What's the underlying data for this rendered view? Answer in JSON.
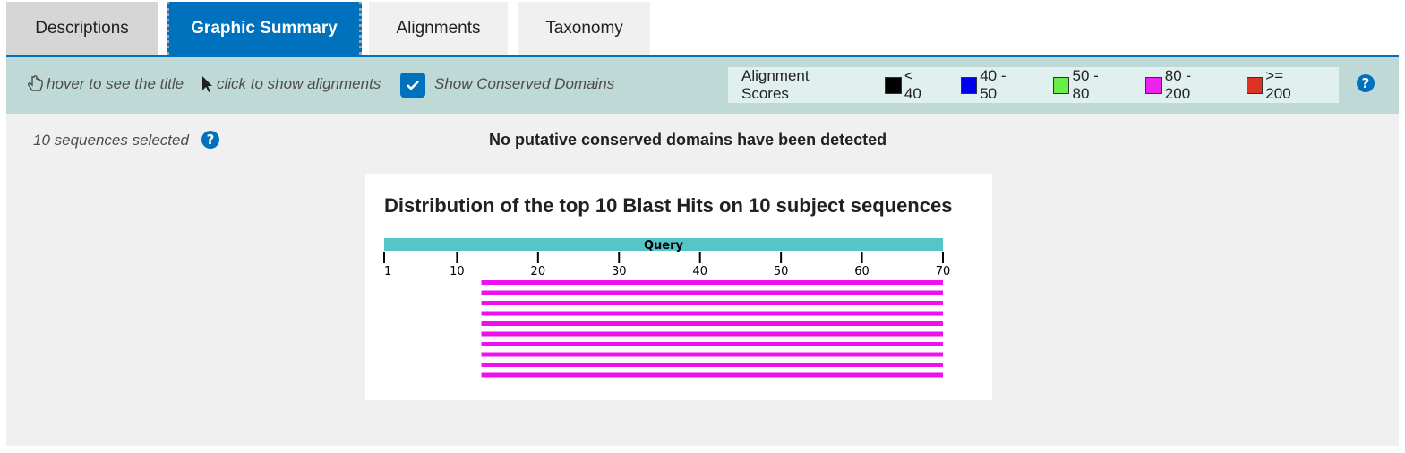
{
  "tabs": [
    {
      "label": "Descriptions",
      "active": false
    },
    {
      "label": "Graphic Summary",
      "active": true
    },
    {
      "label": "Alignments",
      "active": false
    },
    {
      "label": "Taxonomy",
      "active": false
    }
  ],
  "toolbar": {
    "hover_hint": "hover to see the title",
    "click_hint": "click to show alignments",
    "show_cd_label": "Show Conserved Domains",
    "show_cd_checked": true,
    "legend_title": "Alignment Scores",
    "legend": [
      {
        "label": "< 40",
        "color": "#000000"
      },
      {
        "label": "40 - 50",
        "color": "#0000ee"
      },
      {
        "label": "50 - 80",
        "color": "#66ee44"
      },
      {
        "label": "80 - 200",
        "color": "#ee22ee"
      },
      {
        "label": ">= 200",
        "color": "#dd3322"
      }
    ],
    "help_symbol": "?"
  },
  "content": {
    "sequences_selected": "10 sequences selected",
    "no_cd_message": "No putative conserved domains have been detected",
    "help_symbol": "?"
  },
  "graph": {
    "title": "Distribution of the top 10 Blast Hits on 10 subject sequences",
    "query_label": "Query",
    "query_color": "#57c4c7",
    "query_length": 70,
    "ticks": [
      1,
      10,
      20,
      30,
      40,
      50,
      60,
      70
    ],
    "hits": [
      {
        "start": 13,
        "end": 70,
        "color": "#ee11ee"
      },
      {
        "start": 13,
        "end": 70,
        "color": "#ee11ee"
      },
      {
        "start": 13,
        "end": 70,
        "color": "#ee11ee"
      },
      {
        "start": 13,
        "end": 70,
        "color": "#ee11ee"
      },
      {
        "start": 13,
        "end": 70,
        "color": "#ee11ee"
      },
      {
        "start": 13,
        "end": 70,
        "color": "#ee11ee"
      },
      {
        "start": 13,
        "end": 70,
        "color": "#ee11ee"
      },
      {
        "start": 13,
        "end": 70,
        "color": "#ee11ee"
      },
      {
        "start": 13,
        "end": 70,
        "color": "#ee11ee"
      },
      {
        "start": 13,
        "end": 70,
        "color": "#ee11ee"
      }
    ]
  }
}
